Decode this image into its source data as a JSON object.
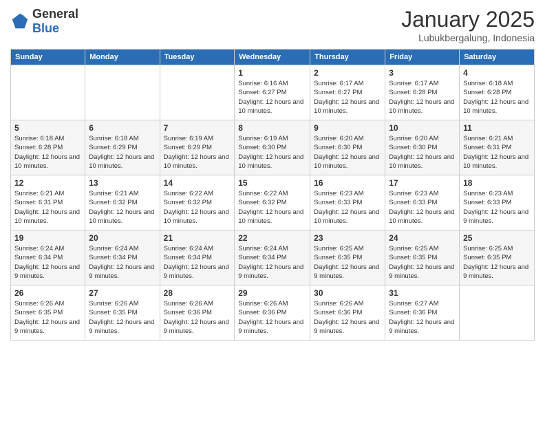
{
  "header": {
    "logo": {
      "general": "General",
      "blue": "Blue"
    },
    "title": "January 2025",
    "location": "Lubukbergalung, Indonesia"
  },
  "weekdays": [
    "Sunday",
    "Monday",
    "Tuesday",
    "Wednesday",
    "Thursday",
    "Friday",
    "Saturday"
  ],
  "weeks": [
    [
      {
        "day": "",
        "info": ""
      },
      {
        "day": "",
        "info": ""
      },
      {
        "day": "",
        "info": ""
      },
      {
        "day": "1",
        "info": "Sunrise: 6:16 AM\nSunset: 6:27 PM\nDaylight: 12 hours and 10 minutes."
      },
      {
        "day": "2",
        "info": "Sunrise: 6:17 AM\nSunset: 6:27 PM\nDaylight: 12 hours and 10 minutes."
      },
      {
        "day": "3",
        "info": "Sunrise: 6:17 AM\nSunset: 6:28 PM\nDaylight: 12 hours and 10 minutes."
      },
      {
        "day": "4",
        "info": "Sunrise: 6:18 AM\nSunset: 6:28 PM\nDaylight: 12 hours and 10 minutes."
      }
    ],
    [
      {
        "day": "5",
        "info": "Sunrise: 6:18 AM\nSunset: 6:28 PM\nDaylight: 12 hours and 10 minutes."
      },
      {
        "day": "6",
        "info": "Sunrise: 6:18 AM\nSunset: 6:29 PM\nDaylight: 12 hours and 10 minutes."
      },
      {
        "day": "7",
        "info": "Sunrise: 6:19 AM\nSunset: 6:29 PM\nDaylight: 12 hours and 10 minutes."
      },
      {
        "day": "8",
        "info": "Sunrise: 6:19 AM\nSunset: 6:30 PM\nDaylight: 12 hours and 10 minutes."
      },
      {
        "day": "9",
        "info": "Sunrise: 6:20 AM\nSunset: 6:30 PM\nDaylight: 12 hours and 10 minutes."
      },
      {
        "day": "10",
        "info": "Sunrise: 6:20 AM\nSunset: 6:30 PM\nDaylight: 12 hours and 10 minutes."
      },
      {
        "day": "11",
        "info": "Sunrise: 6:21 AM\nSunset: 6:31 PM\nDaylight: 12 hours and 10 minutes."
      }
    ],
    [
      {
        "day": "12",
        "info": "Sunrise: 6:21 AM\nSunset: 6:31 PM\nDaylight: 12 hours and 10 minutes."
      },
      {
        "day": "13",
        "info": "Sunrise: 6:21 AM\nSunset: 6:32 PM\nDaylight: 12 hours and 10 minutes."
      },
      {
        "day": "14",
        "info": "Sunrise: 6:22 AM\nSunset: 6:32 PM\nDaylight: 12 hours and 10 minutes."
      },
      {
        "day": "15",
        "info": "Sunrise: 6:22 AM\nSunset: 6:32 PM\nDaylight: 12 hours and 10 minutes."
      },
      {
        "day": "16",
        "info": "Sunrise: 6:23 AM\nSunset: 6:33 PM\nDaylight: 12 hours and 10 minutes."
      },
      {
        "day": "17",
        "info": "Sunrise: 6:23 AM\nSunset: 6:33 PM\nDaylight: 12 hours and 10 minutes."
      },
      {
        "day": "18",
        "info": "Sunrise: 6:23 AM\nSunset: 6:33 PM\nDaylight: 12 hours and 9 minutes."
      }
    ],
    [
      {
        "day": "19",
        "info": "Sunrise: 6:24 AM\nSunset: 6:34 PM\nDaylight: 12 hours and 9 minutes."
      },
      {
        "day": "20",
        "info": "Sunrise: 6:24 AM\nSunset: 6:34 PM\nDaylight: 12 hours and 9 minutes."
      },
      {
        "day": "21",
        "info": "Sunrise: 6:24 AM\nSunset: 6:34 PM\nDaylight: 12 hours and 9 minutes."
      },
      {
        "day": "22",
        "info": "Sunrise: 6:24 AM\nSunset: 6:34 PM\nDaylight: 12 hours and 9 minutes."
      },
      {
        "day": "23",
        "info": "Sunrise: 6:25 AM\nSunset: 6:35 PM\nDaylight: 12 hours and 9 minutes."
      },
      {
        "day": "24",
        "info": "Sunrise: 6:25 AM\nSunset: 6:35 PM\nDaylight: 12 hours and 9 minutes."
      },
      {
        "day": "25",
        "info": "Sunrise: 6:25 AM\nSunset: 6:35 PM\nDaylight: 12 hours and 9 minutes."
      }
    ],
    [
      {
        "day": "26",
        "info": "Sunrise: 6:26 AM\nSunset: 6:35 PM\nDaylight: 12 hours and 9 minutes."
      },
      {
        "day": "27",
        "info": "Sunrise: 6:26 AM\nSunset: 6:35 PM\nDaylight: 12 hours and 9 minutes."
      },
      {
        "day": "28",
        "info": "Sunrise: 6:26 AM\nSunset: 6:36 PM\nDaylight: 12 hours and 9 minutes."
      },
      {
        "day": "29",
        "info": "Sunrise: 6:26 AM\nSunset: 6:36 PM\nDaylight: 12 hours and 9 minutes."
      },
      {
        "day": "30",
        "info": "Sunrise: 6:26 AM\nSunset: 6:36 PM\nDaylight: 12 hours and 9 minutes."
      },
      {
        "day": "31",
        "info": "Sunrise: 6:27 AM\nSunset: 6:36 PM\nDaylight: 12 hours and 9 minutes."
      },
      {
        "day": "",
        "info": ""
      }
    ]
  ]
}
